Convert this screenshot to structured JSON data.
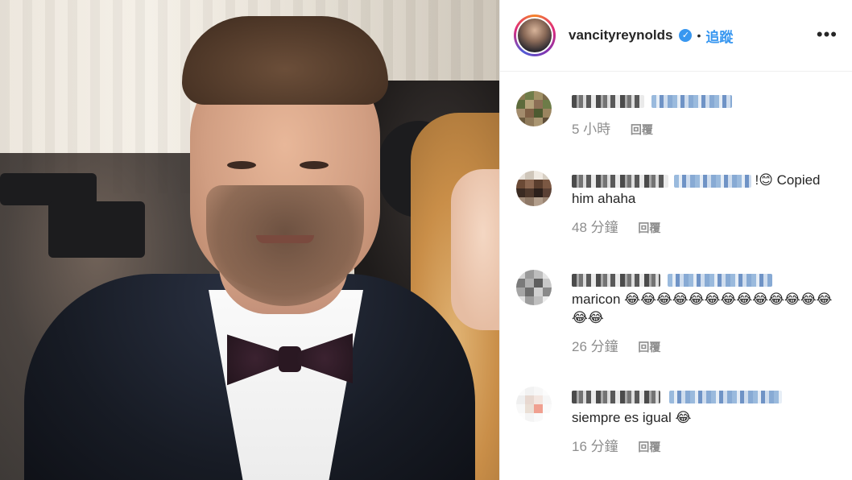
{
  "post": {
    "username": "vancityreynolds",
    "verified_icon": "verified-badge-icon",
    "separator": "•",
    "follow_label": "追蹤",
    "more_icon": "•••"
  },
  "comments": [
    {
      "text": "",
      "time": "5 小時",
      "reply_label": "回覆"
    },
    {
      "text": "!😊 Copied him ahaha",
      "time": "48 分鐘",
      "reply_label": "回覆"
    },
    {
      "text": "maricon 😂😂😂😂😂😂😂😂😂😂😂😂😂😂😂",
      "time": "26 分鐘",
      "reply_label": "回覆"
    },
    {
      "text": "siempre es igual 😂",
      "time": "16 分鐘",
      "reply_label": "回覆"
    }
  ],
  "colors": {
    "accent": "#3897f0",
    "text": "#262626",
    "muted": "#8e8e8e",
    "border": "#efefef"
  }
}
